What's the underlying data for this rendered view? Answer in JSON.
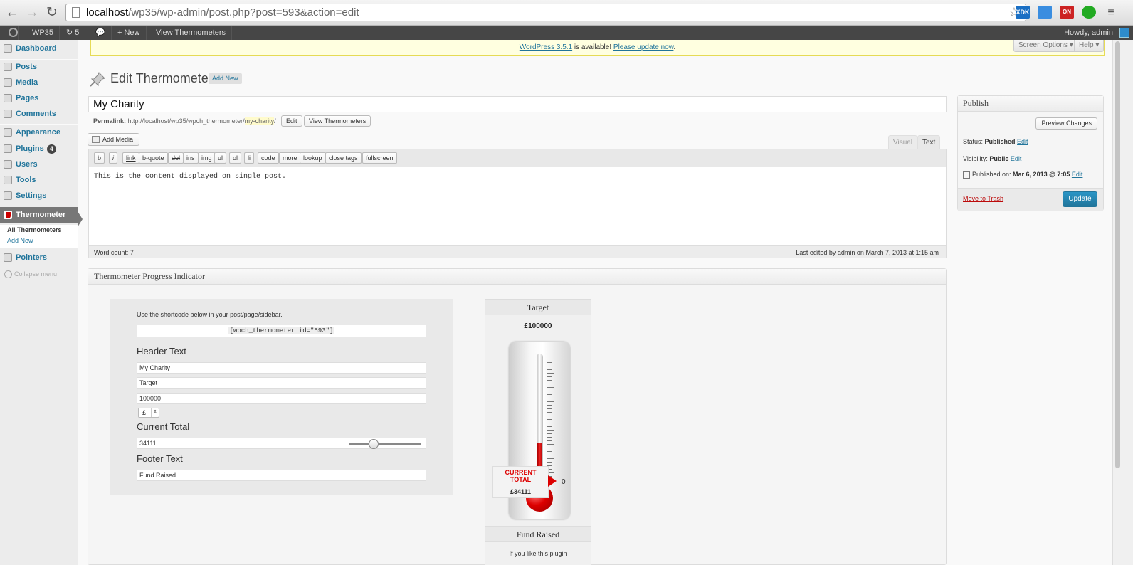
{
  "browser": {
    "url_host": "localhost",
    "url_path": "/wp35/wp-admin/post.php?post=593&action=edit",
    "ext_xdk": "XDK",
    "ext_on": "ON"
  },
  "adminbar": {
    "site": "WP35",
    "updates": "5",
    "new": "New",
    "view": "View Thermometers",
    "howdy": "Howdy, admin"
  },
  "sidebar": {
    "dashboard": "Dashboard",
    "posts": "Posts",
    "media": "Media",
    "pages": "Pages",
    "comments": "Comments",
    "appearance": "Appearance",
    "plugins": "Plugins",
    "plugins_badge": "4",
    "users": "Users",
    "tools": "Tools",
    "settings": "Settings",
    "thermometer": "Thermometer",
    "sub_all": "All Thermometers",
    "sub_add": "Add New",
    "pointers": "Pointers",
    "collapse": "Collapse menu"
  },
  "notice": {
    "link1": "WordPress 3.5.1",
    "mid": " is available! ",
    "link2": "Please update now",
    "end": "."
  },
  "top_tabs": {
    "screen_options": "Screen Options ▾",
    "help": "Help ▾"
  },
  "heading": {
    "title": "Edit Thermometer",
    "add_new": "Add New"
  },
  "post": {
    "title": "My Charity",
    "permalink_label": "Permalink:",
    "permalink_base": "http://localhost/wp35/wpch_thermometer/",
    "permalink_slug": "my-charity",
    "permalink_end": "/",
    "edit_btn": "Edit",
    "view_btn": "View Thermometers",
    "add_media": "Add Media",
    "tab_visual": "Visual",
    "tab_text": "Text",
    "quicktags": [
      "b",
      "i",
      "link",
      "b-quote",
      "del",
      "ins",
      "img",
      "ul",
      "ol",
      "li",
      "code",
      "more",
      "lookup",
      "close tags",
      "fullscreen"
    ],
    "content": "This is the content displayed on single post.",
    "word_count": "Word count: 7",
    "last_edited": "Last edited by admin on March 7, 2013 at 1:15 am"
  },
  "publish": {
    "header": "Publish",
    "preview": "Preview Changes",
    "status_label": "Status: ",
    "status_value": "Published",
    "visibility_label": "Visibility: ",
    "visibility_value": "Public",
    "published_label": "Published on: ",
    "published_value": "Mar 6, 2013 @ 7:05",
    "edit": "Edit",
    "trash": "Move to Trash",
    "update": "Update"
  },
  "thermo_box": {
    "header": "Thermometer Progress Indicator",
    "help": "Use the shortcode below in your post/page/sidebar.",
    "shortcode": "[wpch_thermometer id=\"593\"]",
    "header_text_label": "Header Text",
    "header_value": "My Charity",
    "target_label_value": "Target",
    "target_value": "100000",
    "currency": "£",
    "current_total_label": "Current Total",
    "current_value": "34111",
    "slider_fraction": 0.34111,
    "footer_text_label": "Footer Text",
    "footer_value": "Fund Raised"
  },
  "thermo_widget": {
    "title": "Target",
    "target": "£100000",
    "current_label": "CURRENT\nTOTAL",
    "current_value": "£34111",
    "fill_fraction": 0.34111,
    "zero": "0",
    "footer": "Fund Raised",
    "plug": "If you like this plugin"
  },
  "colors": {
    "link": "#21759b",
    "thermo_red": "#dd0000",
    "adminbar": "#464646"
  }
}
